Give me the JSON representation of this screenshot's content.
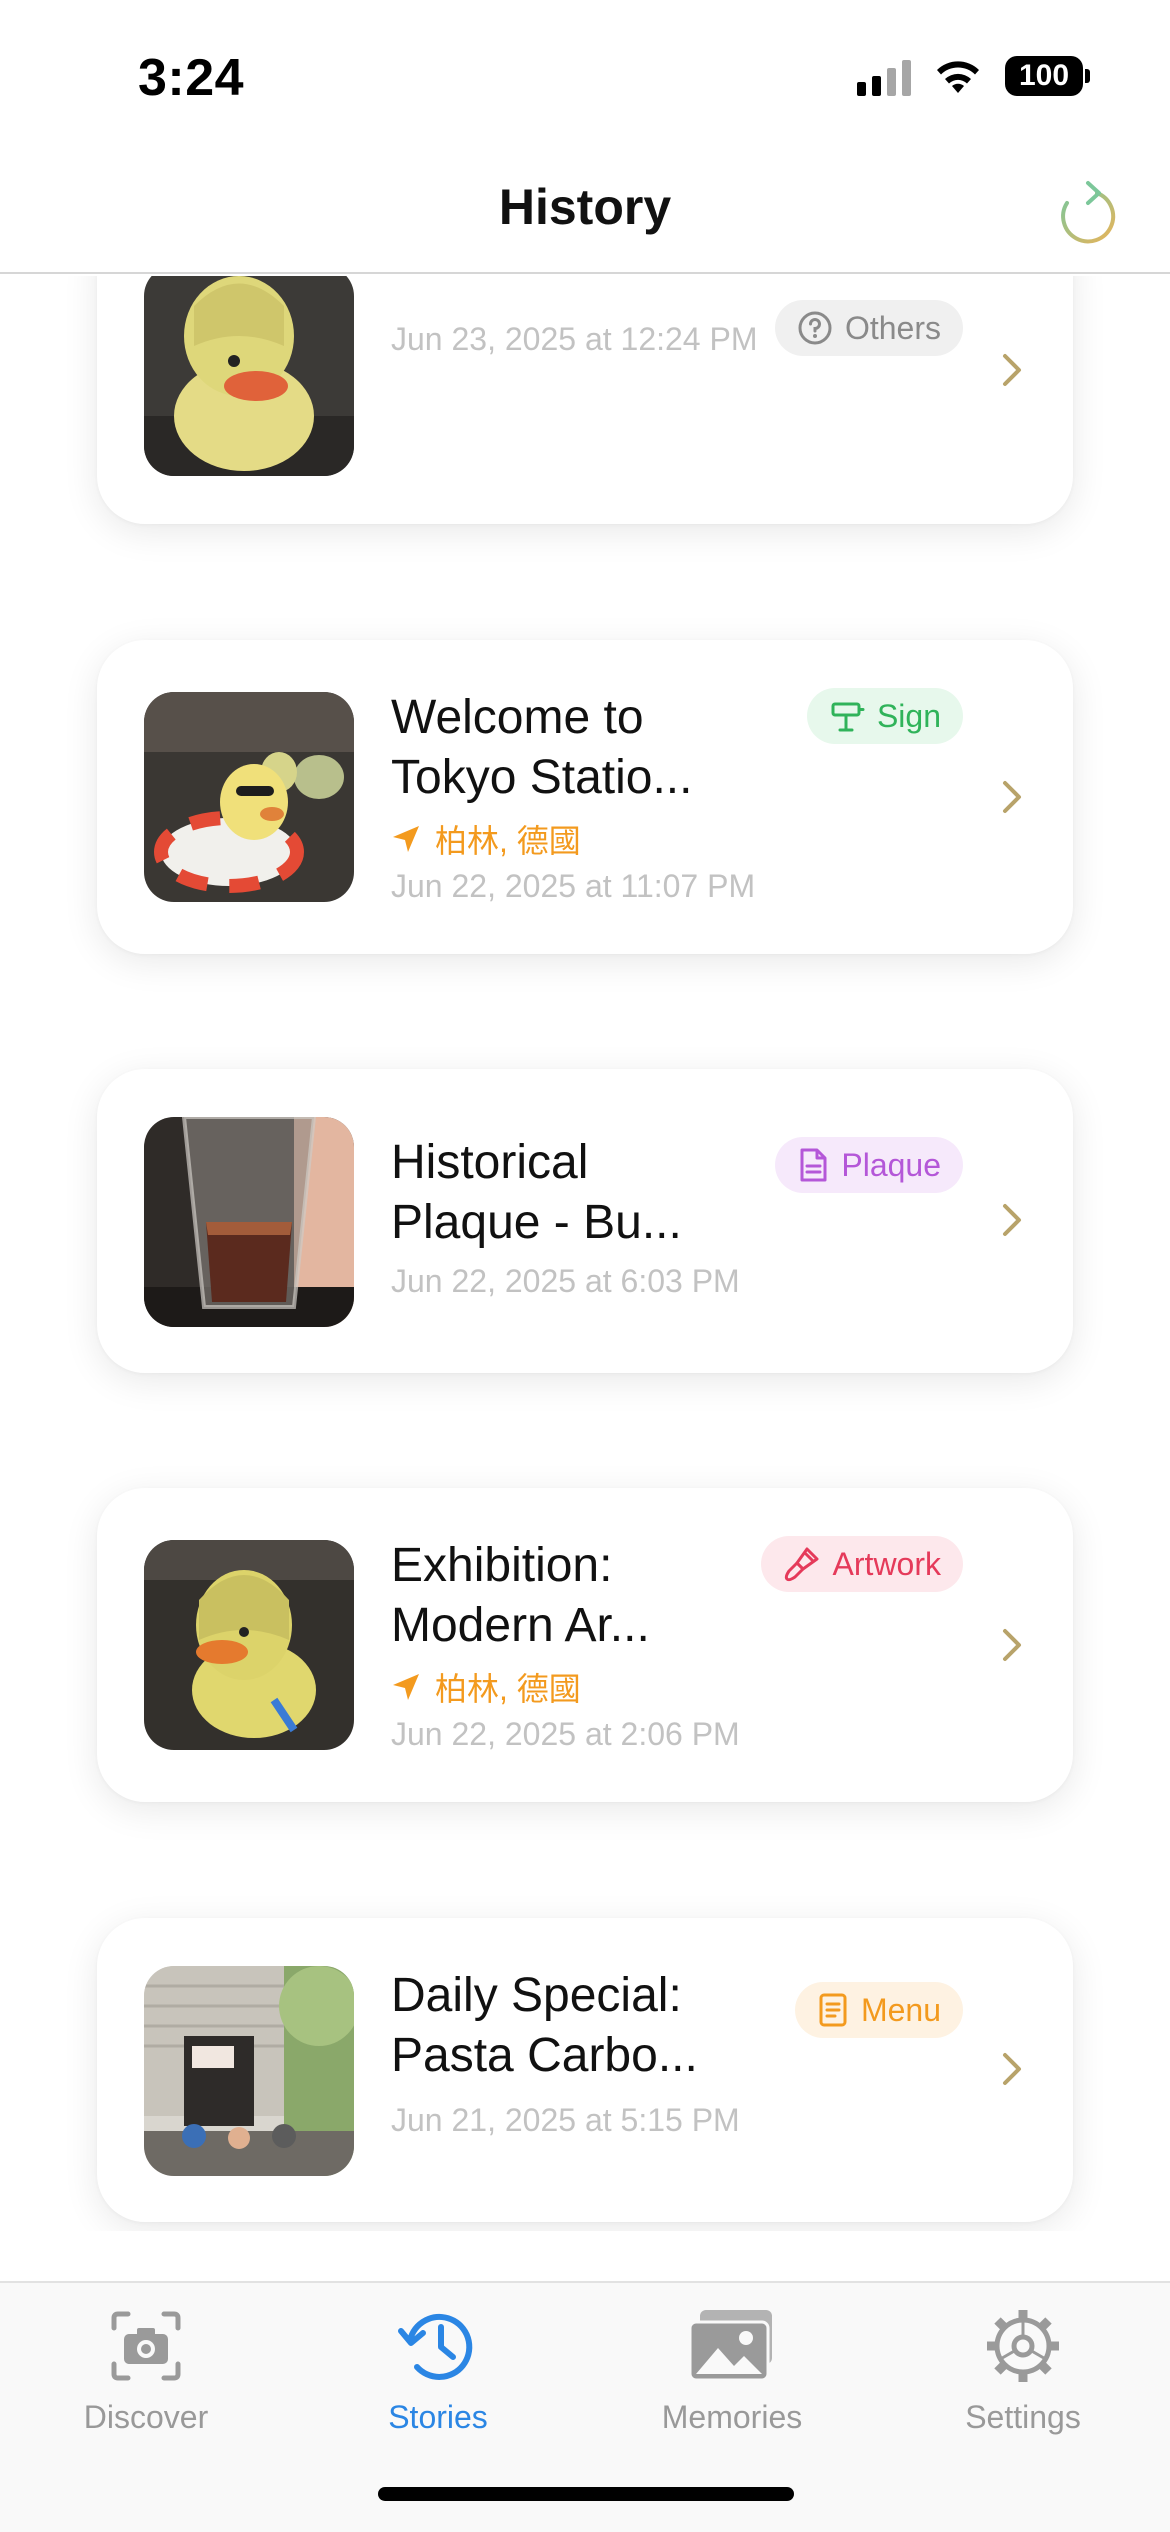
{
  "status_bar": {
    "time": "3:24",
    "battery": "100"
  },
  "header": {
    "title": "History",
    "refresh_icon": "refresh-icon"
  },
  "stories": [
    {
      "title": "",
      "category": "Others",
      "category_icon": "question-circle-icon",
      "location": "",
      "date": "Jun 23, 2025 at 12:24 PM",
      "thumb": "rubber-duck-in-raincoat"
    },
    {
      "title": "Welcome to Tokyo Statio...",
      "category": "Sign",
      "category_icon": "signpost-icon",
      "location": "柏林, 德國",
      "date": "Jun 22, 2025 at 11:07 PM",
      "thumb": "rubber-duck-with-sunglasses-and-float"
    },
    {
      "title": "Historical Plaque - Bu...",
      "category": "Plaque",
      "category_icon": "document-icon",
      "location": "",
      "date": "Jun 22, 2025 at 6:03 PM",
      "thumb": "glass-of-cola"
    },
    {
      "title": "Exhibition: Modern Ar...",
      "category": "Artwork",
      "category_icon": "paintbrush-icon",
      "location": "柏林, 德國",
      "date": "Jun 22, 2025 at 2:06 PM",
      "thumb": "rubber-duck-in-hood"
    },
    {
      "title": "Daily Special: Pasta Carbo...",
      "category": "Menu",
      "category_icon": "menu-list-icon",
      "location": "",
      "date": "Jun 21, 2025 at 5:15 PM",
      "thumb": "street-cafe-facade"
    }
  ],
  "tab_bar": {
    "active": "Stories",
    "tabs": [
      {
        "label": "Discover",
        "icon": "camera-viewfinder-icon"
      },
      {
        "label": "Stories",
        "icon": "clock-history-icon"
      },
      {
        "label": "Memories",
        "icon": "photo-stack-icon"
      },
      {
        "label": "Settings",
        "icon": "gear-icon"
      }
    ]
  },
  "colors": {
    "accent": "#2b86e4",
    "location": "#f39a1e",
    "date": "#c2c2c2",
    "chevron": "#b8a36a",
    "others": "#8a8a8a",
    "sign": "#30b35a",
    "plaque": "#b457d8",
    "artwork": "#e53a5a",
    "menu": "#f39a1e"
  }
}
